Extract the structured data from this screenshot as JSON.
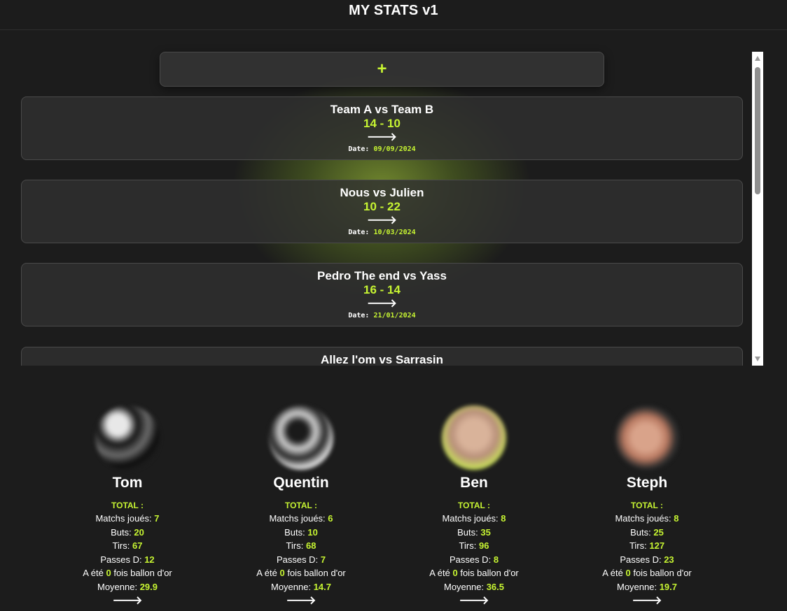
{
  "header": {
    "title": "MY STATS v1"
  },
  "add_button": {
    "label": "+"
  },
  "matches": [
    {
      "title": "Team A vs Team B",
      "score": "14 - 10",
      "arrow": "🡒",
      "date_label": "Date:",
      "date": "09/09/2024"
    },
    {
      "title": "Nous vs Julien",
      "score": "10 - 22",
      "arrow": "🡒",
      "date_label": "Date:",
      "date": "10/03/2024"
    },
    {
      "title": "Pedro The end vs Yass",
      "score": "16 - 14",
      "arrow": "🡒",
      "date_label": "Date:",
      "date": "21/01/2024"
    },
    {
      "title": "Allez l'om vs Sarrasin",
      "score": "",
      "arrow": "",
      "date_label": "",
      "date": ""
    }
  ],
  "players": [
    {
      "name": "Tom",
      "total_label": "TOTAL :",
      "matchs_label": "Matchs joués:",
      "matchs": "7",
      "buts_label": "Buts:",
      "buts": "20",
      "tirs_label": "Tirs:",
      "tirs": "67",
      "passes_label": "Passes D:",
      "passes": "12",
      "ballon_prefix": "A été",
      "ballon": "0",
      "ballon_suffix": "fois ballon d'or",
      "moyenne_label": "Moyenne:",
      "moyenne": "29.9",
      "arrow": "🡒"
    },
    {
      "name": "Quentin",
      "total_label": "TOTAL :",
      "matchs_label": "Matchs joués:",
      "matchs": "6",
      "buts_label": "Buts:",
      "buts": "10",
      "tirs_label": "Tirs:",
      "tirs": "68",
      "passes_label": "Passes D:",
      "passes": "7",
      "ballon_prefix": "A été",
      "ballon": "0",
      "ballon_suffix": "fois ballon d'or",
      "moyenne_label": "Moyenne:",
      "moyenne": "14.7",
      "arrow": "🡒"
    },
    {
      "name": "Ben",
      "total_label": "TOTAL :",
      "matchs_label": "Matchs joués:",
      "matchs": "8",
      "buts_label": "Buts:",
      "buts": "35",
      "tirs_label": "Tirs:",
      "tirs": "96",
      "passes_label": "Passes D:",
      "passes": "8",
      "ballon_prefix": "A été",
      "ballon": "0",
      "ballon_suffix": "fois ballon d'or",
      "moyenne_label": "Moyenne:",
      "moyenne": "36.5",
      "arrow": "🡒"
    },
    {
      "name": "Steph",
      "total_label": "TOTAL :",
      "matchs_label": "Matchs joués:",
      "matchs": "8",
      "buts_label": "Buts:",
      "buts": "25",
      "tirs_label": "Tirs:",
      "tirs": "127",
      "passes_label": "Passes D:",
      "passes": "23",
      "ballon_prefix": "A été",
      "ballon": "0",
      "ballon_suffix": "fois ballon d'or",
      "moyenne_label": "Moyenne:",
      "moyenne": "19.7",
      "arrow": "🡒"
    }
  ],
  "colors": {
    "accent": "#c6f432",
    "background": "#1c1c1c",
    "card": "#303030"
  }
}
